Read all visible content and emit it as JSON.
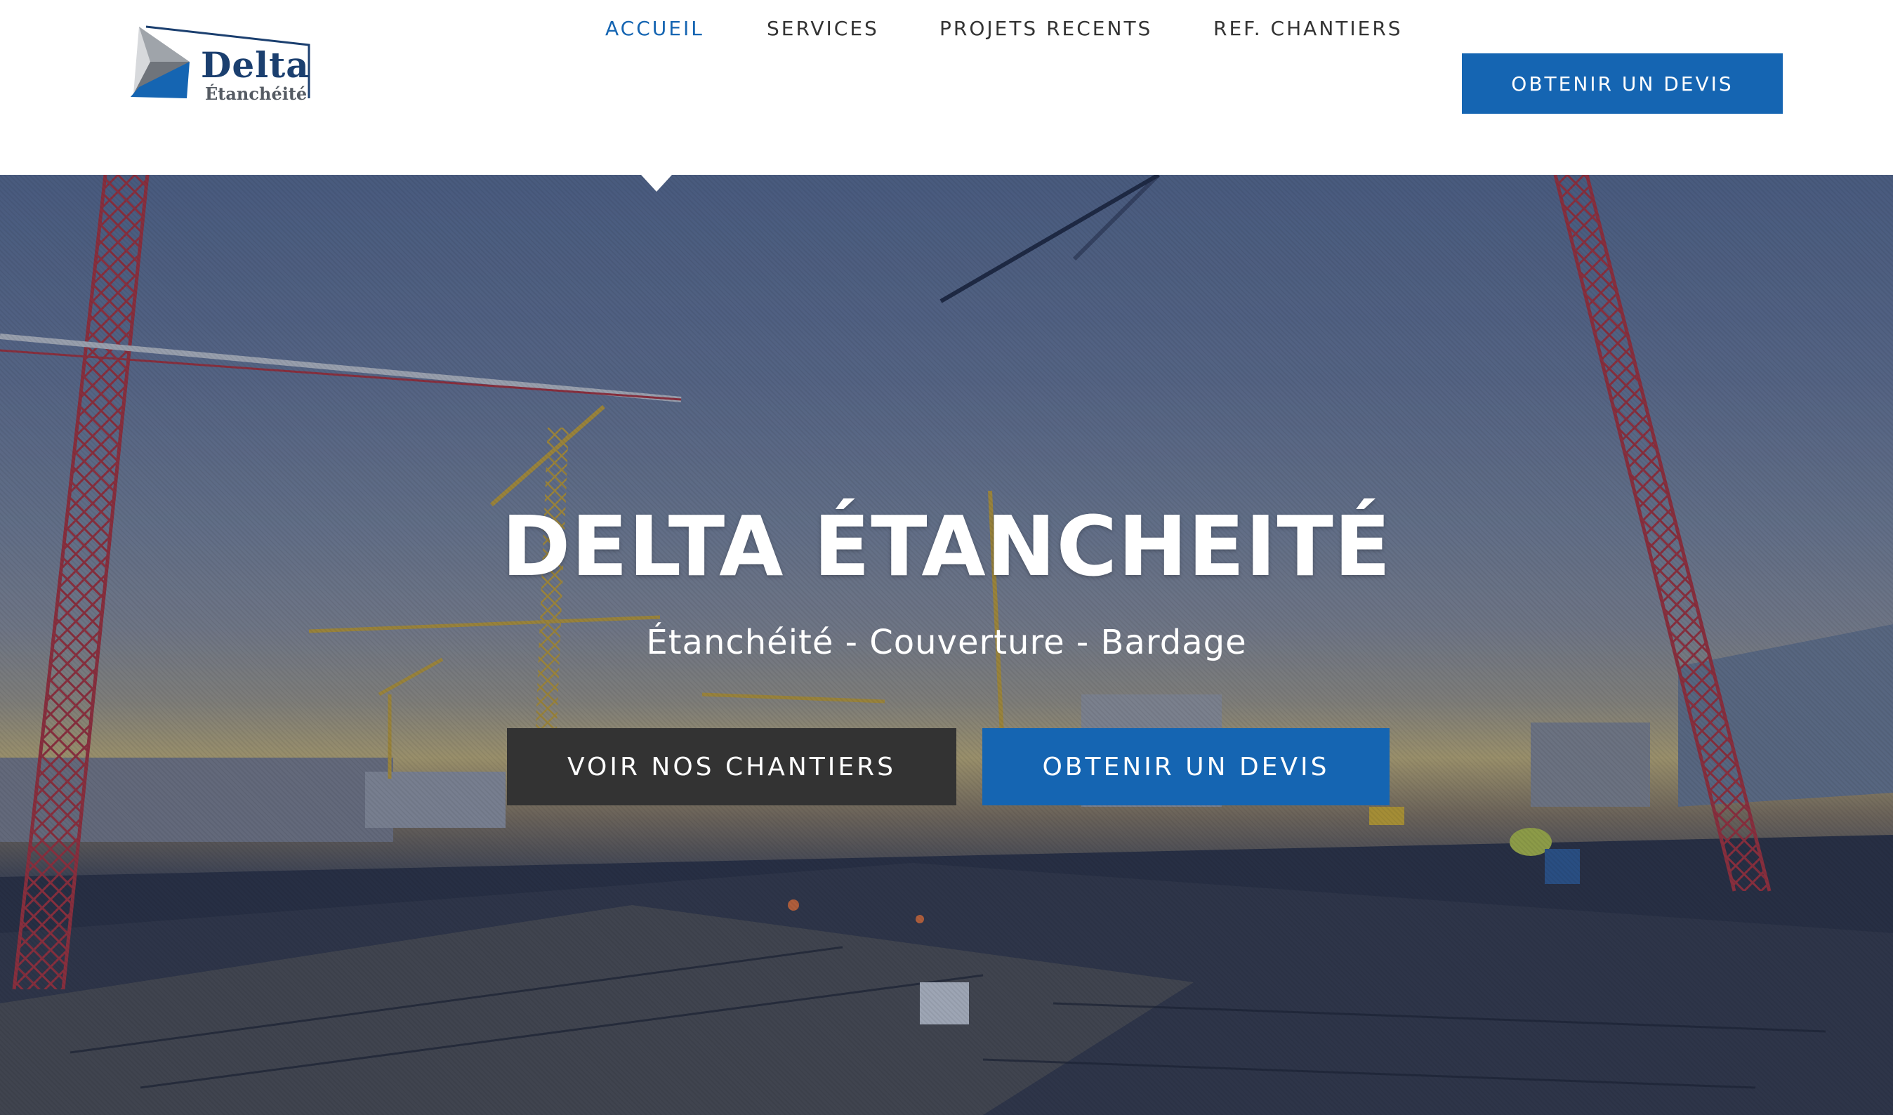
{
  "logo": {
    "title": "Delta",
    "subtitle": "Étanchéité"
  },
  "nav": {
    "items": [
      {
        "label": "ACCUEIL",
        "active": true
      },
      {
        "label": "SERVICES",
        "active": false
      },
      {
        "label": "PROJETS RECENTS",
        "active": false
      },
      {
        "label": "REF. CHANTIERS",
        "active": false
      }
    ],
    "cta_label": "OBTENIR UN DEVIS"
  },
  "hero": {
    "title": "DELTA ÉTANCHEITÉ",
    "subtitle": "Étanchéité - Couverture - Bardage",
    "primary_button": "VOIR NOS CHANTIERS",
    "secondary_button": "OBTENIR UN DEVIS"
  },
  "colors": {
    "accent": "#1565b2",
    "dark_button": "#333333",
    "nav_text": "#333333",
    "white": "#ffffff"
  }
}
